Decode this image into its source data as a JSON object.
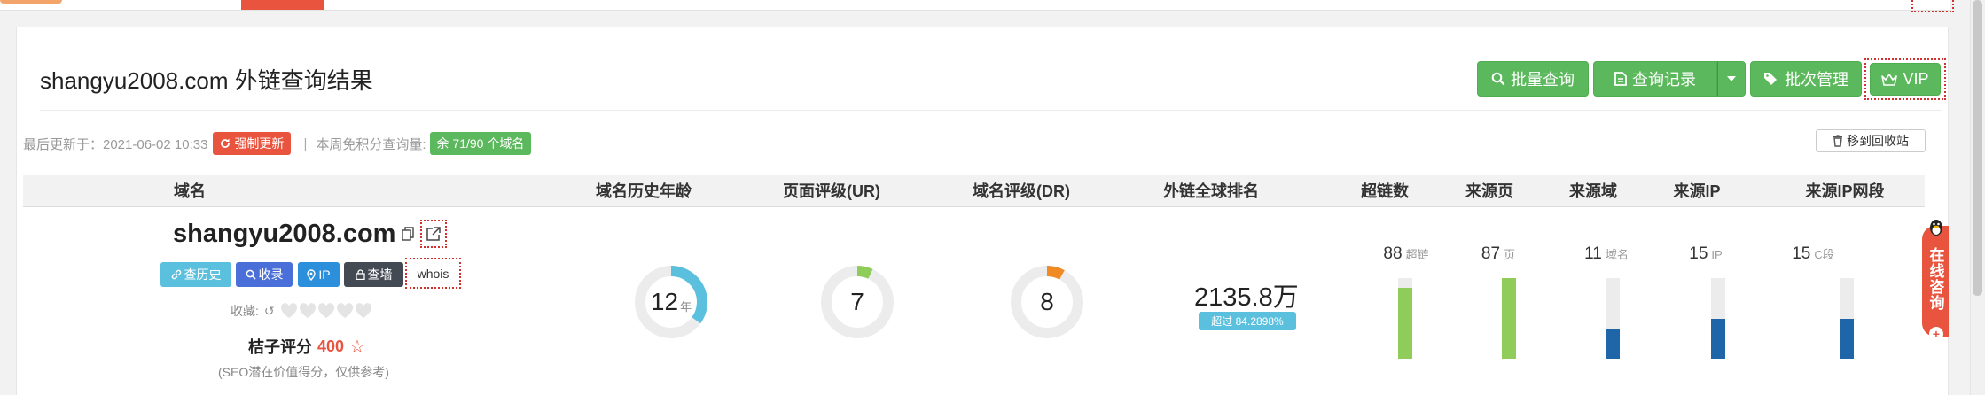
{
  "header": {
    "title": "shangyu2008.com 外链查询结果",
    "buttons": {
      "batch_query": "批量查询",
      "query_record": "查询记录",
      "batch_manage": "批次管理",
      "vip": "VIP"
    }
  },
  "meta": {
    "last_update_label": "最后更新于：2021-06-02 10:33",
    "force_update": "强制更新",
    "separator": "|",
    "quota_label": "本周免积分查询量:",
    "quota_badge": "余 71/90 个域名",
    "recycle": "移到回收站"
  },
  "table": {
    "headers": [
      "域名",
      "域名历史年龄",
      "页面评级(UR)",
      "域名评级(DR)",
      "外链全球排名",
      "超链数",
      "来源页",
      "来源域",
      "来源IP",
      "来源IP网段"
    ]
  },
  "row": {
    "domain": "shangyu2008.com",
    "tags": {
      "history": "查历史",
      "index": "收录",
      "ip": "IP",
      "wall": "查墙",
      "whois": "whois"
    },
    "collect_label": "收藏:",
    "collect_refresh": "↺",
    "favorites": 0,
    "score_label": "桔子评分",
    "score_value": "400",
    "score_star": "☆",
    "score_note": "(SEO潜在价值得分，仅供参考)",
    "age": {
      "value": "12",
      "unit": "年",
      "fraction": 0.35
    },
    "ur": {
      "value": "7",
      "fraction": 0.07
    },
    "dr": {
      "value": "8",
      "fraction": 0.08
    },
    "rank": {
      "value": "2135.8万",
      "badge": "超过 84.2898%"
    },
    "metrics": [
      {
        "value": "88",
        "unit": "超链",
        "fill": 0.88,
        "color": "#8fcc5a"
      },
      {
        "value": "87",
        "unit": "页",
        "fill": 1.0,
        "color": "#8fcc5a"
      },
      {
        "value": "11",
        "unit": "域名",
        "fill": 0.36,
        "color": "#1e66a8"
      },
      {
        "value": "15",
        "unit": "IP",
        "fill": 0.49,
        "color": "#1e66a8"
      },
      {
        "value": "15",
        "unit": "C段",
        "fill": 0.49,
        "color": "#1e66a8"
      }
    ]
  },
  "colors": {
    "green": "#5cb85c",
    "red": "#e9543f",
    "cyan": "#5bc0de",
    "age_arc": "#5bc0de",
    "ur_arc": "#8fcc5a",
    "dr_arc": "#f08a24"
  },
  "consult": {
    "label": "在线咨询",
    "plus": "+"
  }
}
